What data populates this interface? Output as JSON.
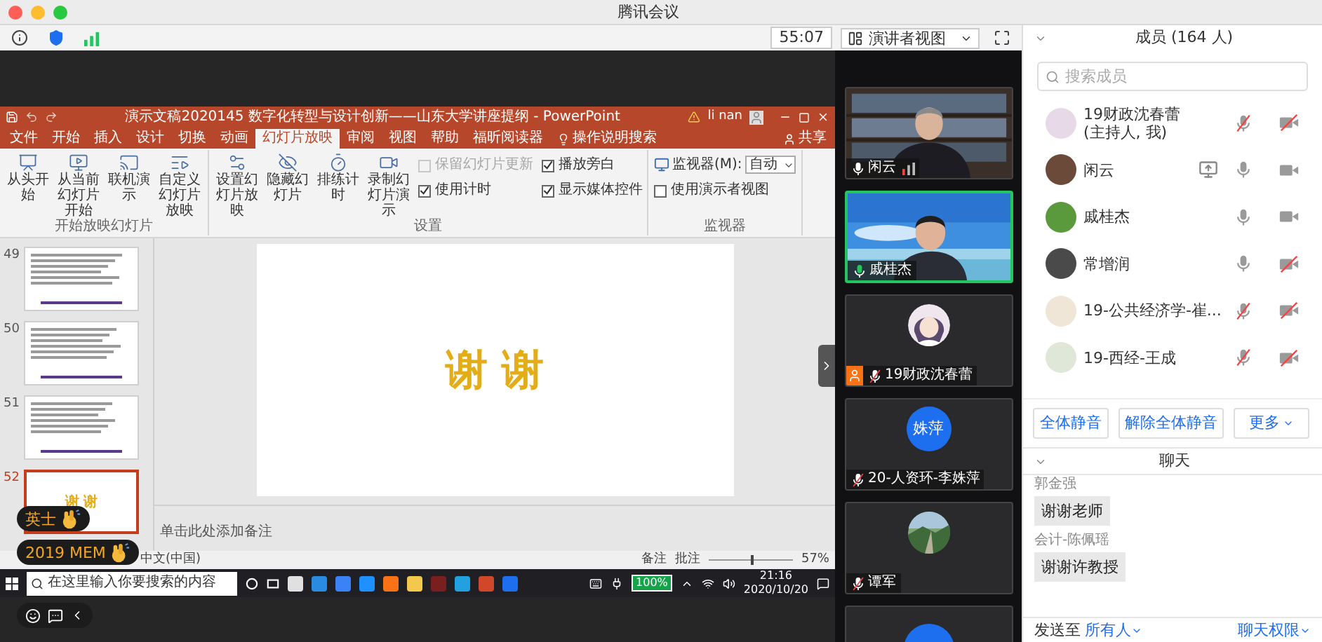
{
  "window": {
    "title": "腾讯会议"
  },
  "toolbar": {
    "timer": "55:07",
    "view_menu": "演讲者视图"
  },
  "shared_screen": {
    "title": "演示文稿2020145 数字化转型与设计创新——山东大学讲座提纲 - PowerPoint",
    "user": "li nan",
    "tabs": [
      {
        "label": "文件",
        "selected": false
      },
      {
        "label": "开始",
        "selected": false
      },
      {
        "label": "插入",
        "selected": false
      },
      {
        "label": "设计",
        "selected": false
      },
      {
        "label": "切换",
        "selected": false
      },
      {
        "label": "动画",
        "selected": false
      },
      {
        "label": "幻灯片放映",
        "selected": true
      },
      {
        "label": "审阅",
        "selected": false
      },
      {
        "label": "视图",
        "selected": false
      },
      {
        "label": "帮助",
        "selected": false
      },
      {
        "label": "福昕阅读器",
        "selected": false
      }
    ],
    "tell_me": "操作说明搜索",
    "share": "共享",
    "groups": [
      {
        "kind": "buttons",
        "label": "开始放映幻灯片",
        "buttons": [
          "从头开始",
          "从当前幻灯片开始",
          "联机演示",
          "自定义幻灯片放映"
        ]
      },
      {
        "kind": "buttons",
        "label": "设置",
        "buttons": [
          "设置幻灯片放映",
          "隐藏幻灯片",
          "排练计时",
          "录制幻灯片演示"
        ],
        "checkboxes": [
          {
            "label": "保留幻灯片更新",
            "checked": false,
            "disabled": true
          },
          {
            "label": "播放旁白",
            "checked": true,
            "disabled": false
          },
          {
            "label": "使用计时",
            "checked": true,
            "disabled": false
          },
          {
            "label": "显示媒体控件",
            "checked": true,
            "disabled": false
          }
        ]
      },
      {
        "kind": "monitor",
        "label": "监视器",
        "monitor_label": "监视器(M):",
        "monitor_value": "自动",
        "checkboxes": [
          {
            "label": "使用演示者视图",
            "checked": false,
            "disabled": false
          }
        ]
      }
    ],
    "slides": [
      {
        "number": "49",
        "kind": "text",
        "selected": false
      },
      {
        "number": "50",
        "kind": "text",
        "selected": false
      },
      {
        "number": "51",
        "kind": "text",
        "selected": false
      },
      {
        "number": "52",
        "kind": "title",
        "title": "谢 谢",
        "selected": true
      }
    ],
    "current_slide": {
      "title": "谢 谢"
    },
    "notes_placeholder": "单击此处添加备注",
    "status_bar": {
      "language": "中文(中国)",
      "notes": "备注",
      "comments": "批注",
      "zoom": "57%",
      "level": 0.5
    },
    "taskbar": {
      "search_placeholder": "在这里输入你要搜索的内容",
      "battery": "100%",
      "time": "21:16",
      "date": "2020/10/20"
    }
  },
  "reactions": [
    {
      "name": "英士"
    },
    {
      "name": "2019 MEM"
    }
  ],
  "video_tiles": [
    {
      "name": "闲云",
      "kind": "video",
      "muted": false,
      "speaking": false,
      "host": false,
      "weak_signal": true
    },
    {
      "name": "戚桂杰",
      "kind": "video",
      "muted": false,
      "speaking": true,
      "host": false,
      "weak_signal": false
    },
    {
      "name": "19财政沈春蕾",
      "kind": "avatar",
      "muted": true,
      "speaking": false,
      "host": true,
      "weak_signal": false
    },
    {
      "name": "20-人资环-李姝萍",
      "kind": "initials",
      "initials": "姝萍",
      "muted": true,
      "speaking": false,
      "host": false,
      "weak_signal": false
    },
    {
      "name": "谭军",
      "kind": "avatar",
      "muted": true,
      "speaking": false,
      "host": false,
      "weak_signal": false
    },
    {
      "kind": "cut"
    }
  ],
  "members": {
    "title": "成员 (164 人)",
    "search_placeholder": "搜索成员",
    "list": [
      {
        "name": "19财政沈春蕾",
        "note": "(主持人, 我)",
        "muted": true,
        "video_on": false,
        "sharing": false
      },
      {
        "name": "闲云",
        "muted": false,
        "video_on": true,
        "sharing": true
      },
      {
        "name": "戚桂杰",
        "muted": false,
        "video_on": true,
        "sharing": false
      },
      {
        "name": "常增润",
        "muted": false,
        "video_on": false,
        "sharing": false
      },
      {
        "name": "19-公共经济学-崔...",
        "muted": true,
        "video_on": false,
        "sharing": false
      },
      {
        "name": "19-西经-王成",
        "muted": true,
        "video_on": false,
        "sharing": false
      }
    ],
    "buttons": [
      {
        "label": "全体静音",
        "kind": "plain"
      },
      {
        "label": "解除全体静音",
        "kind": "plain"
      },
      {
        "label": "更多",
        "kind": "menu"
      }
    ]
  },
  "chat": {
    "title": "聊天",
    "messages": [
      {
        "sender": "郭金强",
        "text": "谢谢老师"
      },
      {
        "sender": "会计-陈佩瑶",
        "text": "谢谢许教授"
      }
    ],
    "send_to_label": "发送至",
    "send_to": "所有人",
    "permissions": "聊天权限"
  }
}
